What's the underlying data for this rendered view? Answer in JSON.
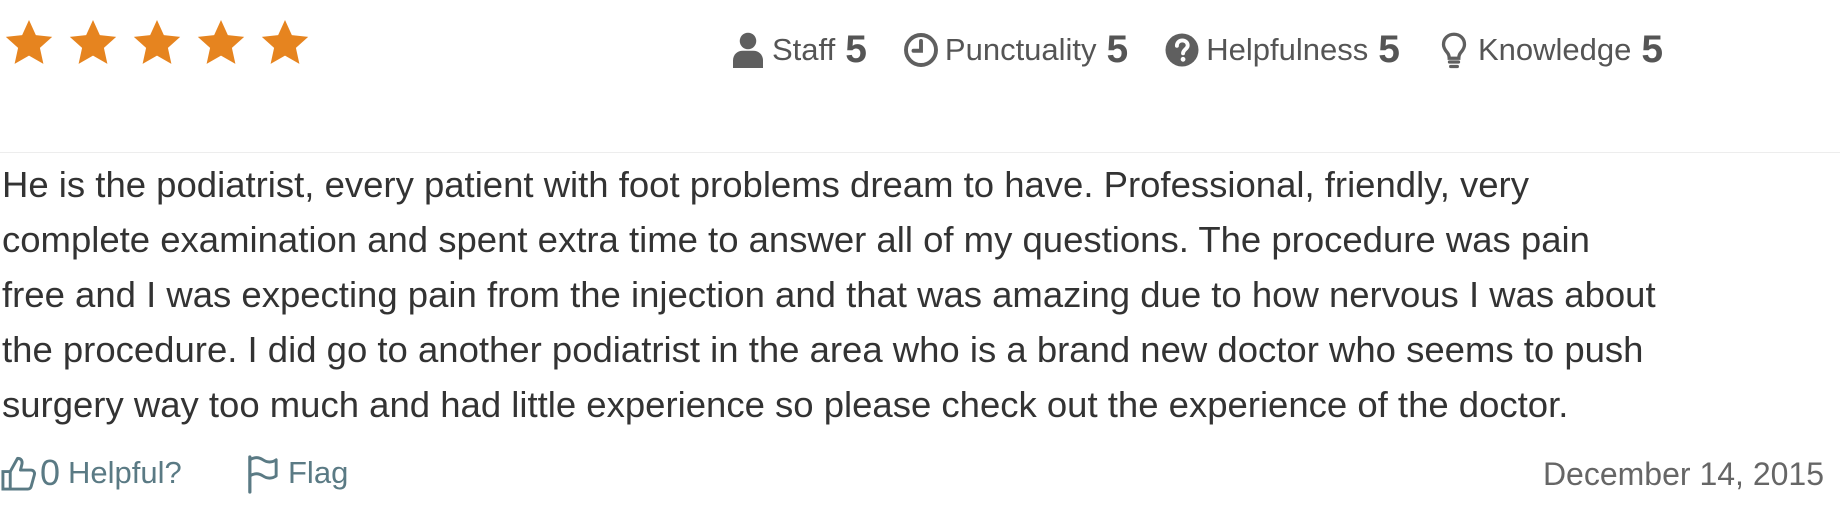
{
  "star_rating": {
    "value": 5,
    "max": 5,
    "color": "#E6841F",
    "icon": "star-icon"
  },
  "ratings": [
    {
      "icon": "user-icon",
      "label": "Staff",
      "value": "5"
    },
    {
      "icon": "clock-icon",
      "label": "Punctuality",
      "value": "5"
    },
    {
      "icon": "question-circle-icon",
      "label": "Helpfulness",
      "value": "5"
    },
    {
      "icon": "lightbulb-icon",
      "label": "Knowledge",
      "value": "5"
    }
  ],
  "review": {
    "lines": [
      "He is the podiatrist, every patient with foot problems dream to have. Professional, friendly, very",
      "complete examination and spent extra time to answer all of my questions. The procedure was pain",
      "free and I was expecting pain from the injection and that was amazing due to how nervous I was about",
      "the procedure. I did go to another podiatrist in the area who is a brand new doctor who seems to push",
      "surgery way too much and had little experience so please check out the experience of the doctor."
    ]
  },
  "footer": {
    "helpful_count": "0",
    "helpful_label": "Helpful?",
    "helpful_icon": "thumbs-up-icon",
    "flag_label": "Flag",
    "flag_icon": "flag-icon",
    "date": "December 14, 2015",
    "link_color": "#5A7A84"
  }
}
